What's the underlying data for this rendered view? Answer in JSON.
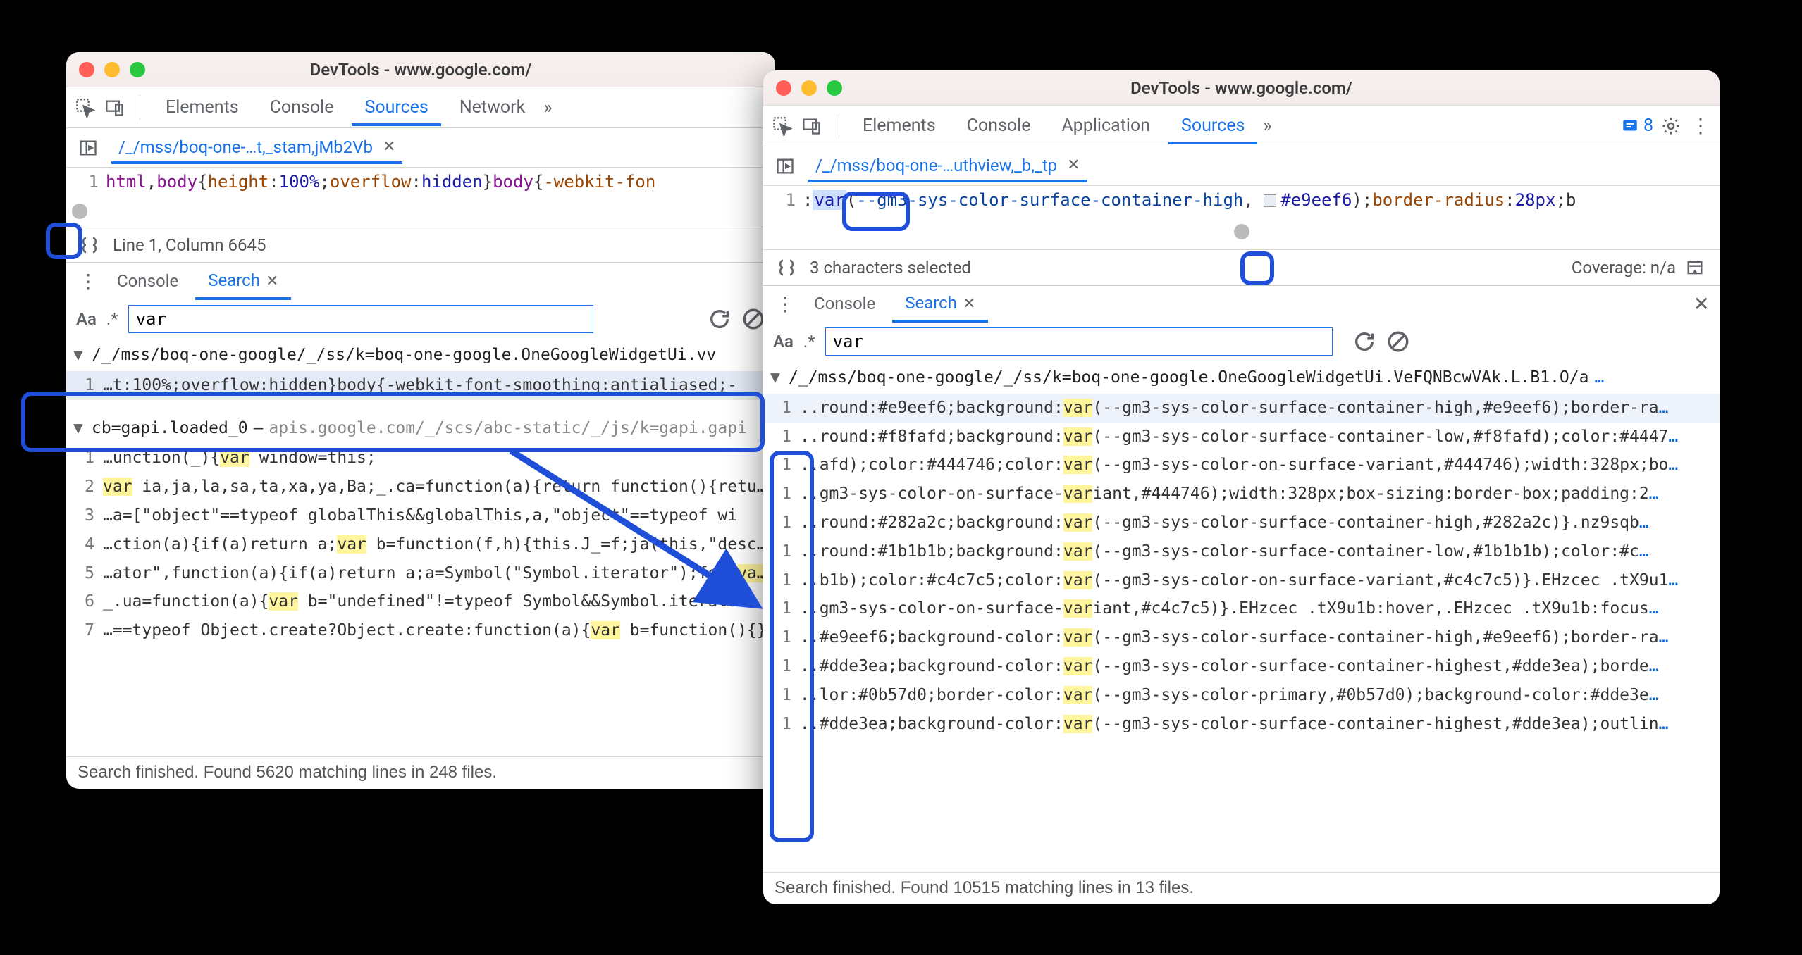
{
  "left": {
    "title": "DevTools - www.google.com/",
    "tabs": {
      "elements": "Elements",
      "console": "Console",
      "sources": "Sources",
      "network": "Network"
    },
    "file_tab": "/_/mss/boq-one-…t,_stam,jMb2Vb",
    "code": {
      "line_no": "1",
      "seg": {
        "a": "html",
        "b": ",",
        "c": "body",
        "d": "{",
        "e": "height",
        "f": ":",
        "g": "100%",
        "h": ";",
        "i": "overflow",
        "j": ":",
        "k": "hidden",
        "l": "}",
        "m": "body",
        "n": "{",
        "o": "-webkit-fon"
      }
    },
    "status": "Line 1, Column 6645",
    "drawer": {
      "console": "Console",
      "search": "Search"
    },
    "search_value": "var",
    "files": [
      {
        "path": "/_/mss/boq-one-google/_/ss/k=boq-one-google.OneGoogleWidgetUi.vv",
        "rows": [
          {
            "ln": "1",
            "pre": "…t:100%;overflow:hidden}body{-webkit-font-smoothing:antialiased;-",
            "hl": "",
            "post": "",
            "selected": true
          }
        ]
      },
      {
        "path": "cb=gapi.loaded_0",
        "note": "apis.google.com/_/scs/abc-static/_/js/k=gapi.gapi",
        "rows": [
          {
            "ln": "1",
            "pre": "…unction(_){",
            "hl": "var",
            "post": " window=this;"
          },
          {
            "ln": "2",
            "pre": "",
            "hl": "var",
            "post": " ia,ja,la,sa,ta,xa,ya,Ba;_.ca=function(a){return function(){return _.ba"
          },
          {
            "ln": "3",
            "pre": "…a=[\"object\"==typeof globalThis&&globalThis,a,\"object\"==typeof wi",
            "hl": "",
            "post": ""
          },
          {
            "ln": "4",
            "pre": "…ction(a){if(a)return a;",
            "hl": "var",
            "post": " b=function(f,h){this.J_=f;ja(this,\"description\""
          },
          {
            "ln": "5",
            "pre": "…ator\",function(a){if(a)return a;a=Symbol(\"Symbol.iterator\");for(",
            "hl": "var",
            "post": " b="
          },
          {
            "ln": "6",
            "pre": "_.ua=function(a){",
            "hl": "var",
            "post": " b=\"undefined\"!=typeof Symbol&&Symbol.iterator"
          },
          {
            "ln": "7",
            "pre": "…==typeof Object.create?Object.create:function(a){",
            "hl": "var",
            "post": " b=function(){}"
          }
        ]
      }
    ],
    "footer": "Search finished.  Found 5620 matching lines in 248 files."
  },
  "right": {
    "title": "DevTools - www.google.com/",
    "tabs": {
      "elements": "Elements",
      "console": "Console",
      "application": "Application",
      "sources": "Sources"
    },
    "issues_count": "8",
    "file_tab": "/_/mss/boq-one-…uthview,_b,_tp",
    "code": {
      "line_no": "1",
      "seg": {
        "a": ":",
        "b": "var",
        "c": "(",
        "d": "--gm3-sys-color-surface-container-high",
        "e": ", ",
        "f": "#e9eef6",
        "g": ");",
        "h": "border-radius",
        "i": ":",
        "j": "28px",
        "k": ";b"
      }
    },
    "status": "3 characters selected",
    "coverage": "Coverage: n/a",
    "drawer": {
      "console": "Console",
      "search": "Search"
    },
    "search_value": "var",
    "file_path": "/_/mss/boq-one-google/_/ss/k=boq-one-google.OneGoogleWidgetUi.VeFQNBcwVAk.L.B1.O/a",
    "rows": [
      {
        "ln": "1",
        "pre": "..round:#e9eef6;background:",
        "hl": "var",
        "post": "(--gm3-sys-color-surface-container-high,#e9eef6);border-ra",
        "selected": true
      },
      {
        "ln": "1",
        "pre": "..round:#f8fafd;background:",
        "hl": "var",
        "post": "(--gm3-sys-color-surface-container-low,#f8fafd);color:#4447"
      },
      {
        "ln": "1",
        "pre": "..afd);color:#444746;color:",
        "hl": "var",
        "post": "(--gm3-sys-color-on-surface-variant,#444746);width:328px;bo"
      },
      {
        "ln": "1",
        "pre": "..gm3-sys-color-on-surface-",
        "hl": "var",
        "post": "iant,#444746);width:328px;box-sizing:border-box;padding:2"
      },
      {
        "ln": "1",
        "pre": "..round:#282a2c;background:",
        "hl": "var",
        "post": "(--gm3-sys-color-surface-container-high,#282a2c)}.nz9sqb"
      },
      {
        "ln": "1",
        "pre": "..round:#1b1b1b;background:",
        "hl": "var",
        "post": "(--gm3-sys-color-surface-container-low,#1b1b1b);color:#c"
      },
      {
        "ln": "1",
        "pre": "..b1b);color:#c4c7c5;color:",
        "hl": "var",
        "post": "(--gm3-sys-color-on-surface-variant,#c4c7c5)}.EHzcec .tX9u1"
      },
      {
        "ln": "1",
        "pre": "..gm3-sys-color-on-surface-",
        "hl": "var",
        "post": "iant,#c4c7c5)}.EHzcec .tX9u1b:hover,.EHzcec .tX9u1b:focus"
      },
      {
        "ln": "1",
        "pre": "..#e9eef6;background-color:",
        "hl": "var",
        "post": "(--gm3-sys-color-surface-container-high,#e9eef6);border-ra"
      },
      {
        "ln": "1",
        "pre": "..#dde3ea;background-color:",
        "hl": "var",
        "post": "(--gm3-sys-color-surface-container-highest,#dde3ea);borde"
      },
      {
        "ln": "1",
        "pre": "..lor:#0b57d0;border-color:",
        "hl": "var",
        "post": "(--gm3-sys-color-primary,#0b57d0);background-color:#dde3e"
      },
      {
        "ln": "1",
        "pre": "..#dde3ea;background-color:",
        "hl": "var",
        "post": "(--gm3-sys-color-surface-container-highest,#dde3ea);outlin"
      }
    ],
    "footer": "Search finished.  Found 10515 matching lines in 13 files."
  }
}
